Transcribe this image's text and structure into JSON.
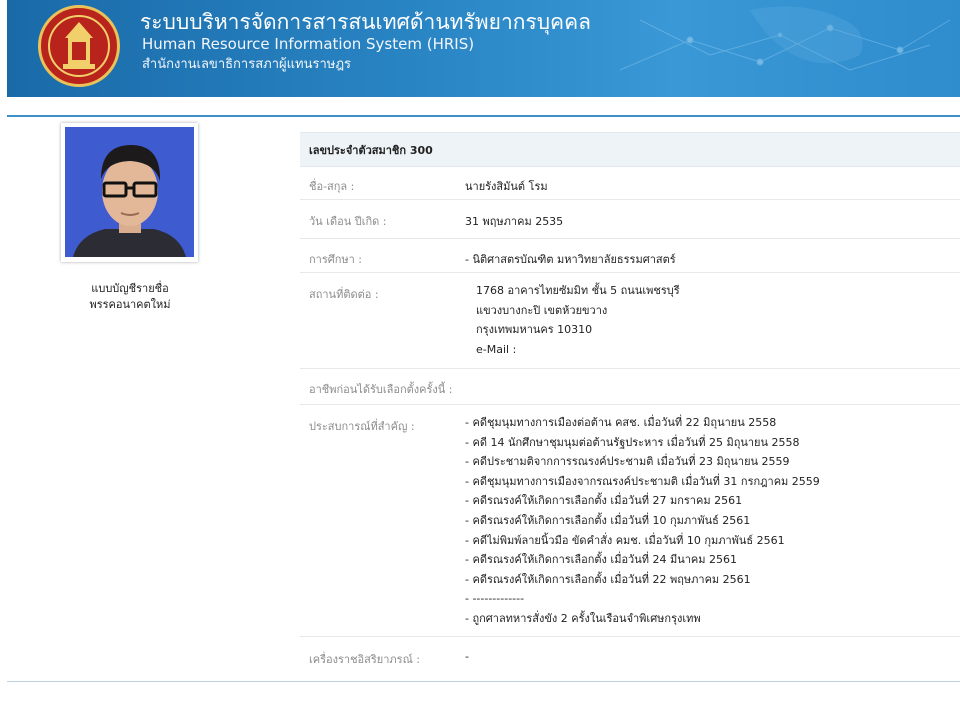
{
  "header": {
    "title_th": "ระบบบริหารจัดการสารสนเทศด้านทรัพยากรบุคคล",
    "title_en": "Human Resource Information System (HRIS)",
    "org_th": "สำนักงานเลขาธิการสภาผู้แทนราษฎร"
  },
  "profile": {
    "member_type_line1": "แบบบัญชีรายชื่อ",
    "member_type_line2": "พรรคอนาคตใหม่"
  },
  "details": {
    "member_id_label": "เลขประจำตัวสมาชิก 300",
    "name_label": "ชื่อ-สกุล :",
    "name_value": "นายรังสิมันต์ โรม",
    "birth_label": "วัน เดือน ปีเกิด :",
    "birth_value": "31 พฤษภาคม 2535",
    "education_label": "การศึกษา :",
    "education_value": "- นิติศาสตรบัณฑิต มหาวิทยาลัยธรรมศาสตร์",
    "address_label": "สถานที่ติดต่อ :",
    "address_lines": [
      "1768 อาคารไทยซัมมิท ชั้น 5 ถนนเพชรบุรี",
      "แขวงบางกะปิ เขตห้วยขวาง",
      "กรุงเทพมหานคร 10310",
      "e-Mail :"
    ],
    "occupation_label": "อาชีพก่อนได้รับเลือกตั้งครั้งนี้ :",
    "experience_label": "ประสบการณ์ที่สำคัญ :",
    "experience_items": [
      "- คดีชุมนุมทางการเมืองต่อต้าน คสช. เมื่อวันที่ 22 มิถุนายน 2558",
      "- คดี 14 นักศึกษาชุมนุมต่อต้านรัฐประหาร เมื่อวันที่ 25 มิถุนายน 2558",
      "- คดีประชามติจากการรณรงค์ประชามติ เมื่อวันที่ 23 มิถุนายน 2559",
      "- คดีชุมนุมทางการเมืองจากรณรงค์ประชามติ เมื่อวันที่ 31 กรกฎาคม 2559",
      "- คดีรณรงค์ให้เกิดการเลือกตั้ง เมื่อวันที่ 27 มกราคม 2561",
      "- คดีรณรงค์ให้เกิดการเลือกตั้ง เมื่อวันที่ 10 กุมภาพันธ์ 2561",
      "- คดีไม่พิมพ์ลายนิ้วมือ ขัดคำสั่ง คมช. เมื่อวันที่ 10 กุมภาพันธ์ 2561",
      "- คดีรณรงค์ให้เกิดการเลือกตั้ง เมื่อวันที่ 24 มีนาคม 2561",
      "- คดีรณรงค์ให้เกิดการเลือกตั้ง เมื่อวันที่ 22 พฤษภาคม 2561",
      "- -------------",
      "- ถูกศาลทหารสั่งขัง 2 ครั้งในเรือนจำพิเศษกรุงเทพ"
    ],
    "decorations_label": "เครื่องราชอิสริยาภรณ์ :",
    "decorations_value": "-"
  },
  "icons": {
    "emblem": "parliament-emblem-icon",
    "photo": "member-photo"
  },
  "colors": {
    "banner_blue": "#2a86c5",
    "divider_blue": "#3d8fc9",
    "label_gray": "#8c8c8c",
    "header_row_bg": "#eef3f7"
  }
}
